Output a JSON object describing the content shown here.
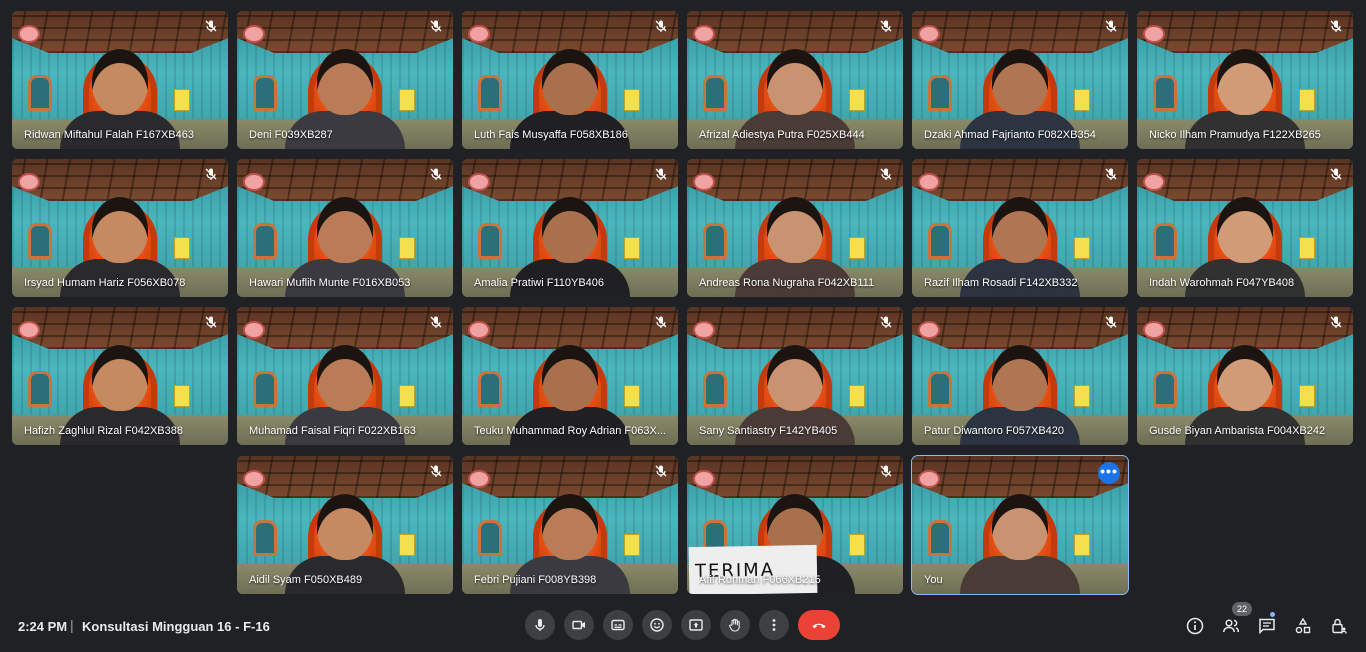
{
  "participants": [
    {
      "name": "Ridwan Miftahul Falah F167XB463",
      "muted": true
    },
    {
      "name": "Deni F039XB287",
      "muted": true
    },
    {
      "name": "Luth Fais Musyaffa F058XB186",
      "muted": true
    },
    {
      "name": "Afrizal Adiestya Putra F025XB444",
      "muted": true
    },
    {
      "name": "Dzaki Ahmad Fajrianto F082XB354",
      "muted": true
    },
    {
      "name": "Nicko Ilham Pramudya F122XB265",
      "muted": true
    },
    {
      "name": "Irsyad Humam Hariz F056XB078",
      "muted": true
    },
    {
      "name": "Hawari Muflih Munte F016XB053",
      "muted": true
    },
    {
      "name": "Amalia Pratiwi F110YB406",
      "muted": true
    },
    {
      "name": "Andreas Rona Nugraha F042XB111",
      "muted": true
    },
    {
      "name": "Razif Ilham Rosadi F142XB332",
      "muted": true
    },
    {
      "name": "Indah Warohmah F047YB408",
      "muted": true
    },
    {
      "name": "Hafizh Zaghlul Rizal F042XB388",
      "muted": true
    },
    {
      "name": "Muhamad Faisal Fiqri F022XB163",
      "muted": true
    },
    {
      "name": "Teuku Muhammad Roy Adrian F063X...",
      "muted": true
    },
    {
      "name": "Sany Santiastry F142YB405",
      "muted": true
    },
    {
      "name": "Patur Diwantoro F057XB420",
      "muted": true
    },
    {
      "name": "Gusde Biyan Ambarista F004XB242",
      "muted": true
    },
    {
      "name": "Aidil Syam F050XB489",
      "muted": true
    },
    {
      "name": "Febri Pujiani F008YB398",
      "muted": true
    },
    {
      "name": "Afif Rohman F066XB215",
      "muted": true,
      "sign": "TERIMA"
    },
    {
      "name": "You",
      "muted": false,
      "self": true
    }
  ],
  "footer": {
    "time": "2:24 PM",
    "separator": "|",
    "meeting_title": "Konsultasi Mingguan 16 - F-16",
    "people_count": "22"
  },
  "controls": [
    {
      "name": "microphone",
      "icon": "mic-icon"
    },
    {
      "name": "camera",
      "icon": "camera-icon"
    },
    {
      "name": "captions",
      "icon": "captions-icon"
    },
    {
      "name": "reactions",
      "icon": "emoji-icon"
    },
    {
      "name": "present",
      "icon": "present-icon"
    },
    {
      "name": "raise-hand",
      "icon": "hand-icon"
    },
    {
      "name": "more-options",
      "icon": "more-vert-icon"
    },
    {
      "name": "leave-call",
      "icon": "hangup-icon"
    }
  ],
  "colors": {
    "background": "#202124",
    "control": "#3c4043",
    "end_call": "#ea4335",
    "accent": "#8ab4f8"
  }
}
